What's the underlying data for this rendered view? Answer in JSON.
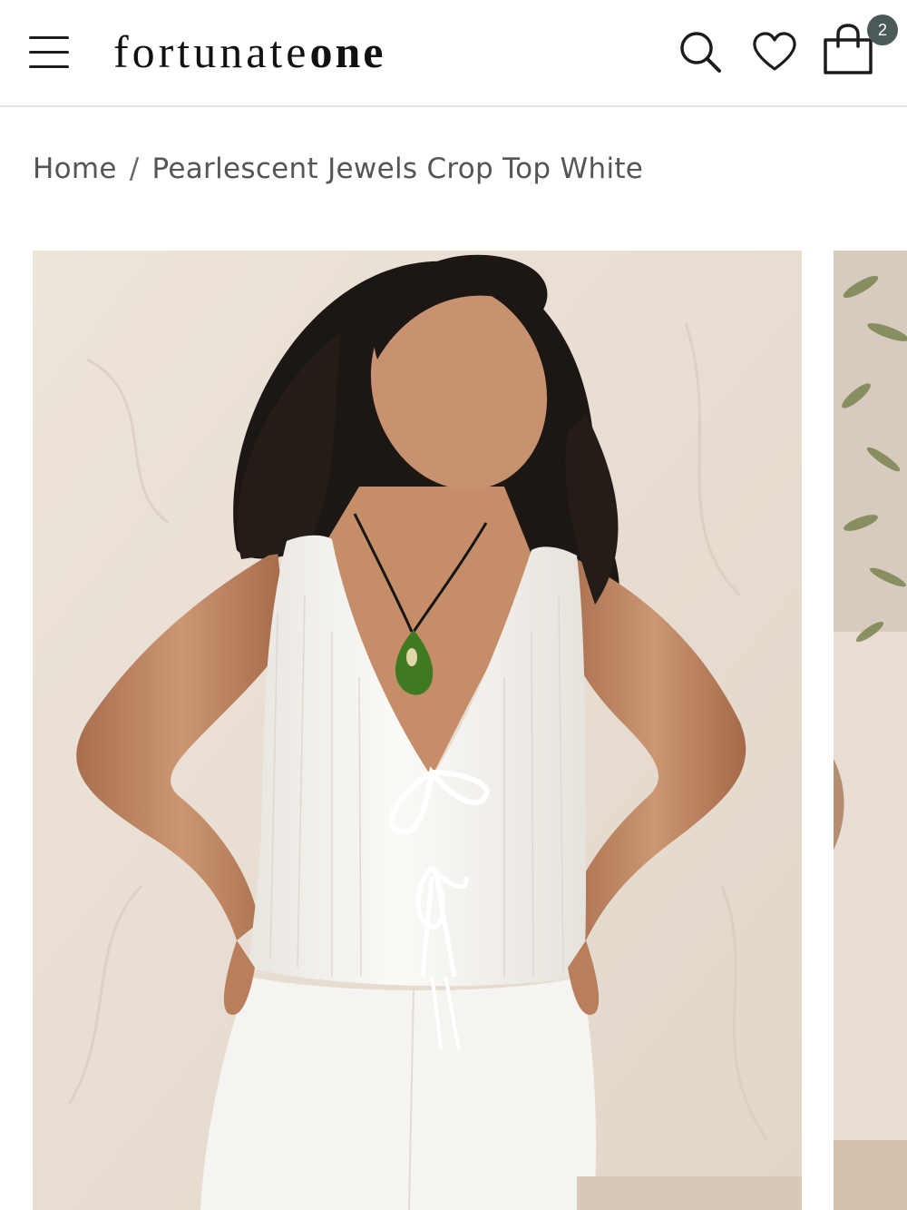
{
  "header": {
    "logo": {
      "part1": "fortunate",
      "part2": "one"
    },
    "cart_count": "2",
    "icons": {
      "menu": "hamburger-menu-icon",
      "search": "search-icon",
      "wishlist": "heart-icon",
      "cart": "shopping-bag-icon"
    }
  },
  "breadcrumb": {
    "home": "Home",
    "separator": "/",
    "current": "Pearlescent Jewels Crop Top White"
  },
  "gallery": {
    "images": [
      {
        "alt": "Model wearing white tie-front crop top and shorts"
      },
      {
        "alt": "Next product image"
      }
    ]
  },
  "colors": {
    "badge": "#4a5a58",
    "wall": "#ebe1d7",
    "garment": "#f7f5f1",
    "hair": "#1d1713",
    "skin": "#c58d68",
    "pendant": "#3f7a22"
  }
}
